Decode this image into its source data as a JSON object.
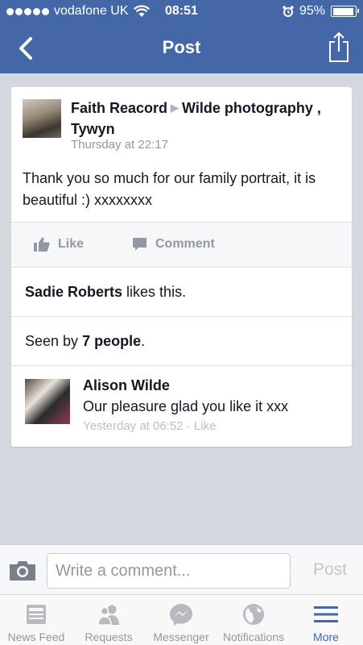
{
  "status_bar": {
    "carrier": "vodafone UK",
    "time": "08:51",
    "battery": "95%",
    "battery_level": 0.95
  },
  "nav": {
    "title": "Post"
  },
  "post": {
    "author": "Faith Reacord",
    "target": "Wilde photography , Tywyn",
    "timestamp": "Thursday at 22:17",
    "text": "Thank you so much for our family portrait, it is beautiful :) xxxxxxxx",
    "like_label": "Like",
    "comment_label": "Comment",
    "likes": {
      "name": "Sadie Roberts",
      "suffix": " likes this."
    },
    "seen": {
      "prefix": "Seen by ",
      "count": "7 people",
      "suffix": "."
    }
  },
  "comment": {
    "author": "Alison Wilde",
    "text": "Our pleasure glad you like it xxx",
    "time": "Yesterday at 06:52",
    "separator": " · ",
    "like_label": "Like"
  },
  "composer": {
    "placeholder": "Write a comment...",
    "post_label": "Post"
  },
  "tabs": [
    {
      "label": "News Feed",
      "icon": "news-feed-icon"
    },
    {
      "label": "Requests",
      "icon": "friend-requests-icon"
    },
    {
      "label": "Messenger",
      "icon": "messenger-icon"
    },
    {
      "label": "Notifications",
      "icon": "globe-icon"
    },
    {
      "label": "More",
      "icon": "menu-icon",
      "active": true
    }
  ],
  "colors": {
    "brand": "#4467a7",
    "background": "#d4d7dd",
    "muted_text": "#9197a3"
  }
}
